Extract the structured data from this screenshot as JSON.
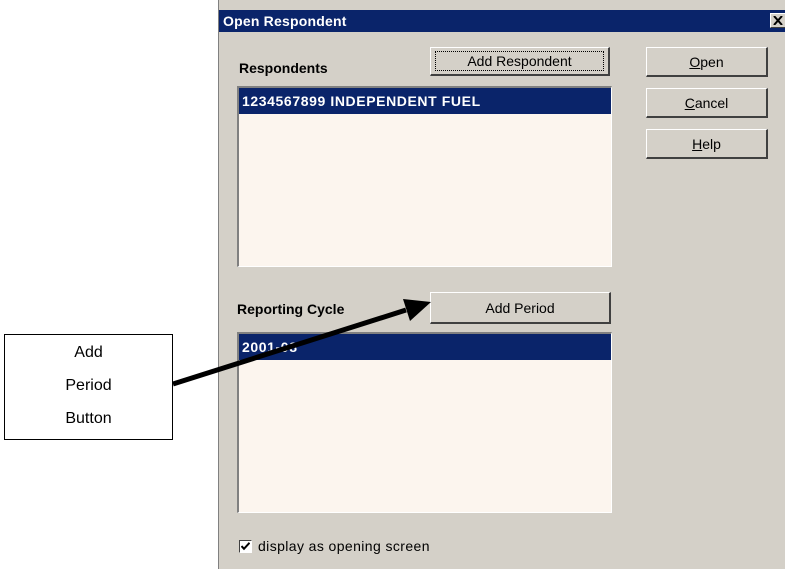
{
  "dialog": {
    "title": "Open Respondent",
    "close_glyph": "✕"
  },
  "respondents": {
    "label": "Respondents",
    "add_button": "Add Respondent",
    "items": [
      "1234567899 INDEPENDENT FUEL"
    ]
  },
  "reporting_cycle": {
    "label": "Reporting Cycle",
    "add_button": "Add Period",
    "items": [
      "2001-08"
    ]
  },
  "buttons": {
    "open": {
      "accel": "O",
      "rest": "pen"
    },
    "cancel": {
      "accel": "C",
      "rest": "ancel"
    },
    "help": {
      "accel": "H",
      "rest": "elp"
    }
  },
  "options": {
    "display_as_opening_screen": {
      "label": "display as opening screen",
      "checked": true
    }
  },
  "callout": {
    "lines": [
      "Add",
      "Period",
      "Button"
    ]
  },
  "colors": {
    "titlebar": "#0a246a",
    "selection": "#0a246a",
    "dialog_face": "#d4d0c8",
    "list_background": "#fcf5ee"
  }
}
